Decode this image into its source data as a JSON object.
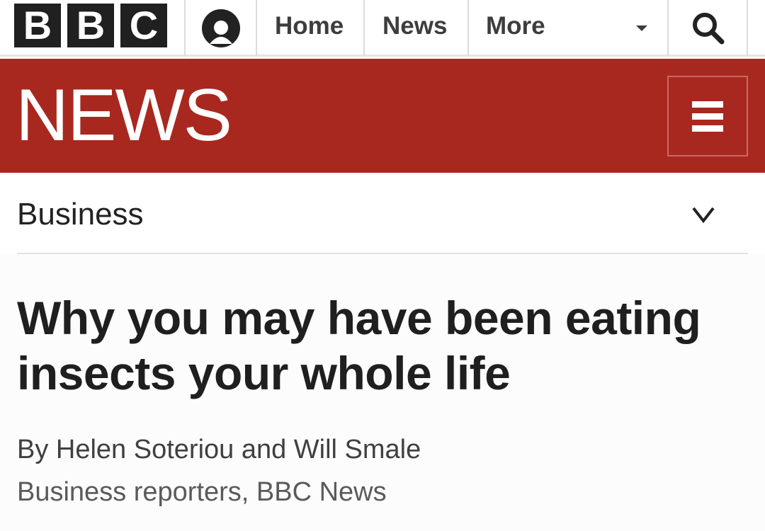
{
  "header": {
    "logo_letters": [
      "B",
      "B",
      "C"
    ],
    "account_icon": "account-icon",
    "nav": [
      {
        "label": "Home"
      },
      {
        "label": "News"
      },
      {
        "label": "More"
      }
    ],
    "more_icon": "caret-down-icon",
    "search_icon": "search-icon"
  },
  "banner": {
    "title": "NEWS",
    "menu_icon": "hamburger-menu-icon",
    "color": "#a8281f"
  },
  "section": {
    "label": "Business",
    "chevron_icon": "chevron-down-icon"
  },
  "article": {
    "headline": "Why you may have been eating insects your whole life",
    "byline": "By Helen Soteriou and Will Smale",
    "role": "Business reporters, BBC News"
  }
}
